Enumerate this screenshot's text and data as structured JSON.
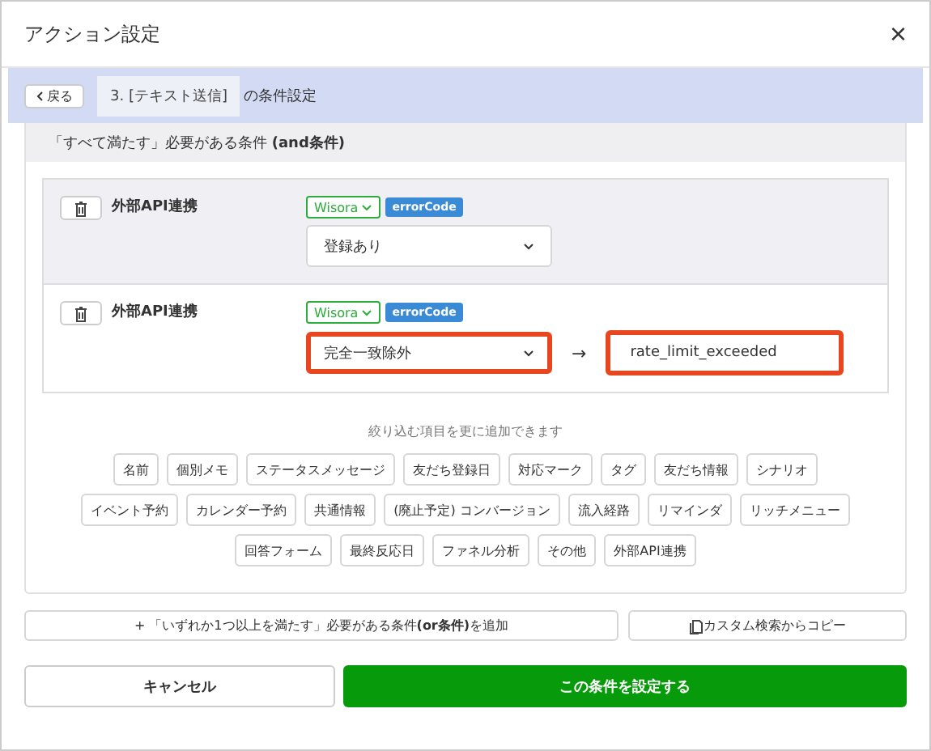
{
  "window": {
    "title": "アクション設定",
    "close": "×"
  },
  "breadcrumb": {
    "back": "戻る",
    "step": "3. [テキスト送信]",
    "suffix": "の条件設定"
  },
  "and_section": {
    "title": "「すべて満たす」必要がある条件 **(and条件)**",
    "conditions": [
      {
        "label": "外部API連携",
        "source": "Wisora",
        "field": "errorCode",
        "operator": "登録あり",
        "hovered": true,
        "highlighted": false
      },
      {
        "label": "外部API連携",
        "source": "Wisora",
        "field": "errorCode",
        "operator": "完全一致除外",
        "arrow": "→",
        "value": "rate_limit_exceeded",
        "hovered": false,
        "highlighted": true
      }
    ],
    "hint": "絞り込む項目を更に追加できます",
    "tag_rows": [
      {
        "items": [
          "名前",
          "個別メモ",
          "ステータスメッセージ",
          "友だち登録日",
          "対応マーク",
          "タグ",
          "友だち情報",
          "シナリオ"
        ]
      },
      {
        "items": [
          "イベント予約",
          "カレンダー予約",
          "共通情報",
          "(廃止予定) コンバージョン",
          "流入経路",
          "リマインダ",
          "リッチメニュー"
        ]
      },
      {
        "items": [
          "回答フォーム",
          "最終反応日",
          "ファネル分析",
          "その他",
          "外部API連携"
        ]
      }
    ]
  },
  "add_or": "+ 「いずれか1つ以上を満たす」必要がある条件**(or条件)**を追加",
  "copy": "カスタム検索からコピー",
  "buttons": [
    {
      "label": "キャンセル",
      "kind": "secondary"
    },
    {
      "label": "この条件を設定する",
      "kind": "primary"
    }
  ]
}
